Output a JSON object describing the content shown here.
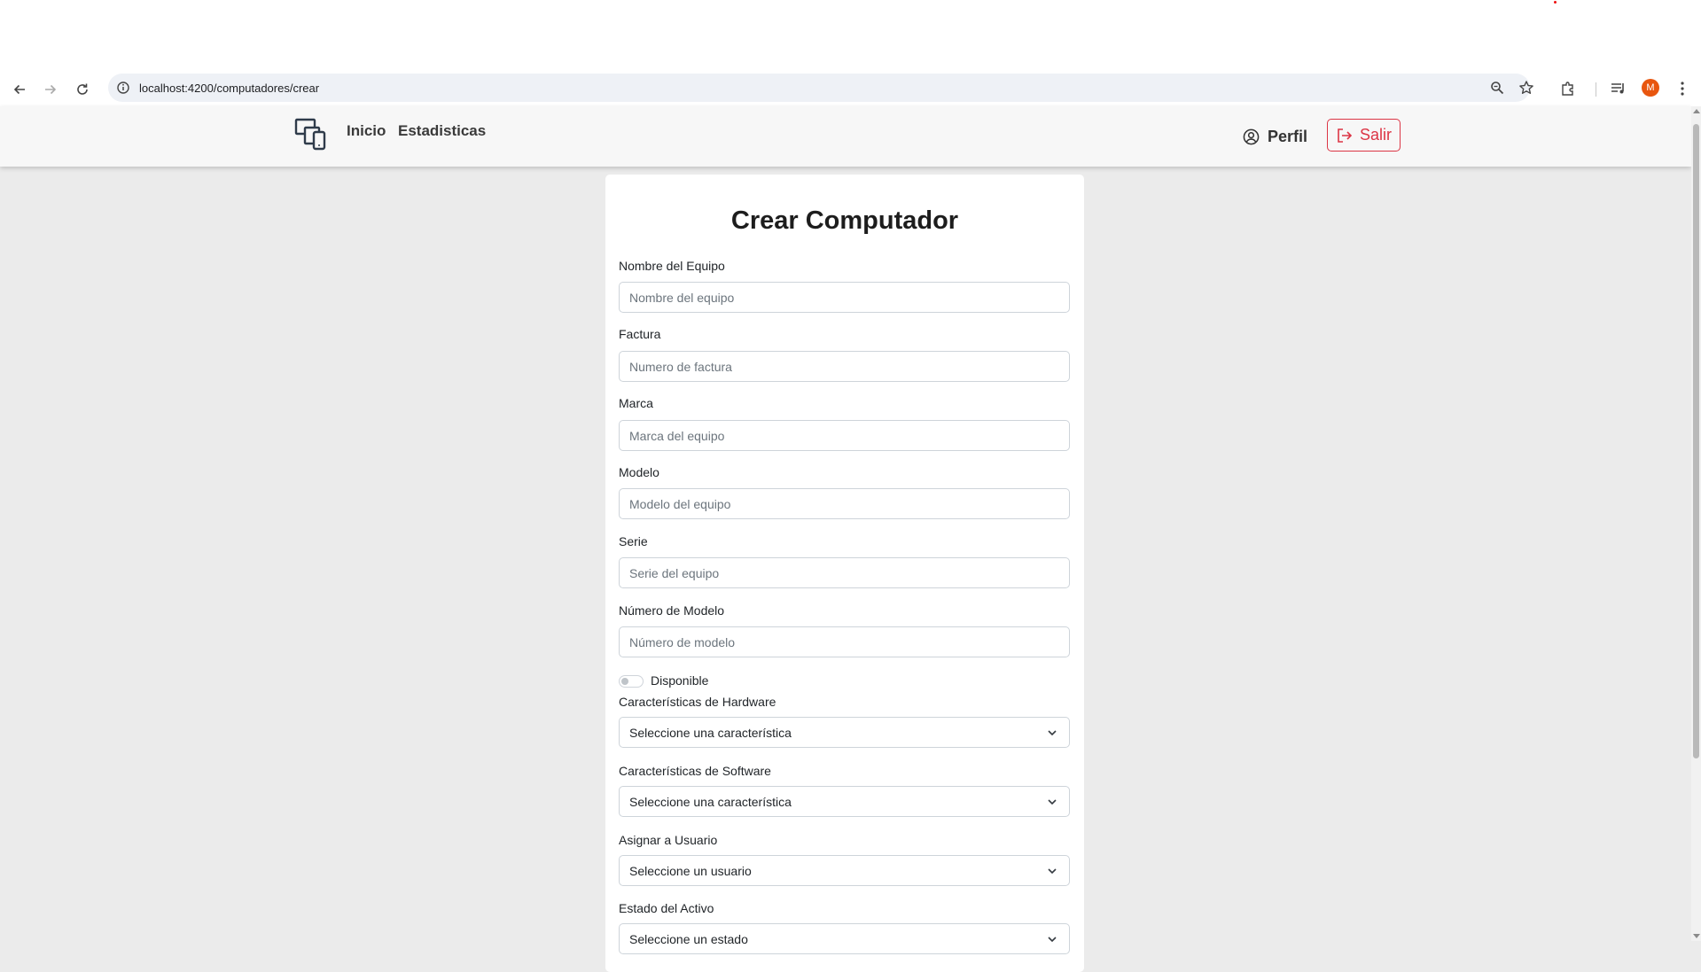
{
  "browser": {
    "url": "localhost:4200/computadores/crear",
    "avatar_letter": "M"
  },
  "navbar": {
    "inicio": "Inicio",
    "estadisticas": "Estadisticas",
    "perfil": "Perfil",
    "salir": "Salir"
  },
  "form": {
    "title": "Crear Computador",
    "nombre": {
      "label": "Nombre del Equipo",
      "placeholder": "Nombre del equipo"
    },
    "factura": {
      "label": "Factura",
      "placeholder": "Numero de factura"
    },
    "marca": {
      "label": "Marca",
      "placeholder": "Marca del equipo"
    },
    "modelo": {
      "label": "Modelo",
      "placeholder": "Modelo del equipo"
    },
    "serie": {
      "label": "Serie",
      "placeholder": "Serie del equipo"
    },
    "numero_modelo": {
      "label": "Número de Modelo",
      "placeholder": "Número de modelo"
    },
    "disponible": {
      "label": "Disponible",
      "checked": false
    },
    "hardware": {
      "label": "Características de Hardware",
      "selected": "Seleccione una característica"
    },
    "software": {
      "label": "Características de Software",
      "selected": "Seleccione una característica"
    },
    "usuario": {
      "label": "Asignar a Usuario",
      "selected": "Seleccione un usuario"
    },
    "estado": {
      "label": "Estado del Activo",
      "selected": "Seleccione un estado"
    }
  },
  "colors": {
    "danger": "#dc3545",
    "page_bg": "#ebebeb",
    "avatar": "#e8560f"
  }
}
